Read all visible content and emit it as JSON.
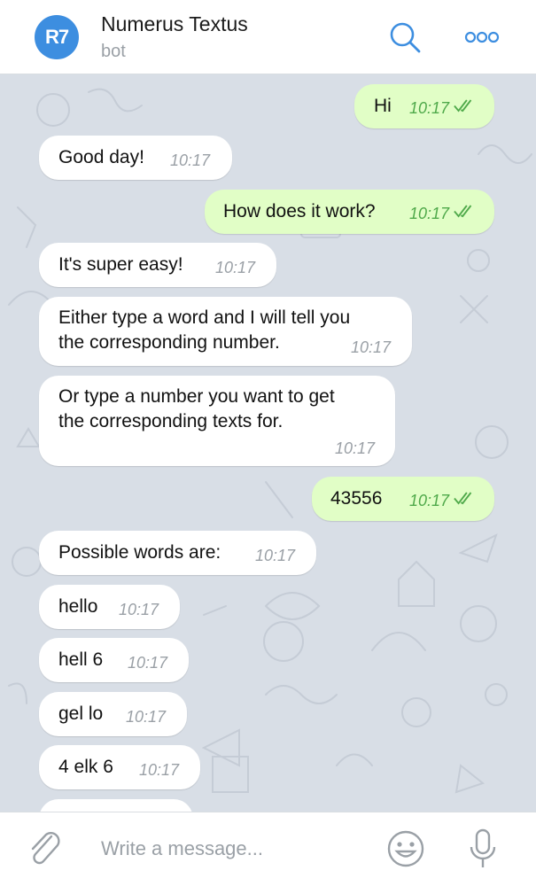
{
  "header": {
    "avatar_text": "R7",
    "title": "Numerus Textus",
    "subtitle": "bot",
    "search_icon": "search-icon",
    "more_icon": "more-dots-icon"
  },
  "colors": {
    "accent": "#3d8ee0",
    "chat_bg": "#d8dee6",
    "incoming_bubble": "#ffffff",
    "outgoing_bubble": "#e1fec6",
    "outgoing_time": "#4fa94a"
  },
  "messages": [
    {
      "direction": "out",
      "text": "Hi",
      "time": "10:17",
      "read": true
    },
    {
      "direction": "in",
      "text": "Good day!",
      "time": "10:17"
    },
    {
      "direction": "out",
      "text": "How does it work?",
      "time": "10:17",
      "read": true
    },
    {
      "direction": "in",
      "text": "It's super easy!",
      "time": "10:17"
    },
    {
      "direction": "in",
      "text": "Either type a word and I will tell you",
      "text2": "the corresponding number.",
      "time": "10:17"
    },
    {
      "direction": "in",
      "text": "Or type a number you want to get",
      "text2": "the corresponding texts for.",
      "time": "10:17"
    },
    {
      "direction": "out",
      "text": "43556",
      "time": "10:17",
      "read": true
    },
    {
      "direction": "in",
      "text": "Possible words are:",
      "time": "10:17"
    },
    {
      "direction": "in",
      "text": "hello",
      "time": "10:17"
    },
    {
      "direction": "in",
      "text": "hell 6",
      "time": "10:17"
    },
    {
      "direction": "in",
      "text": "gel lo",
      "time": "10:17"
    },
    {
      "direction": "in",
      "text": "4 elk 6",
      "time": "10:17"
    }
  ],
  "composer": {
    "placeholder": "Write a message...",
    "attach_icon": "paperclip-icon",
    "emoji_icon": "emoji-icon",
    "mic_icon": "microphone-icon"
  }
}
